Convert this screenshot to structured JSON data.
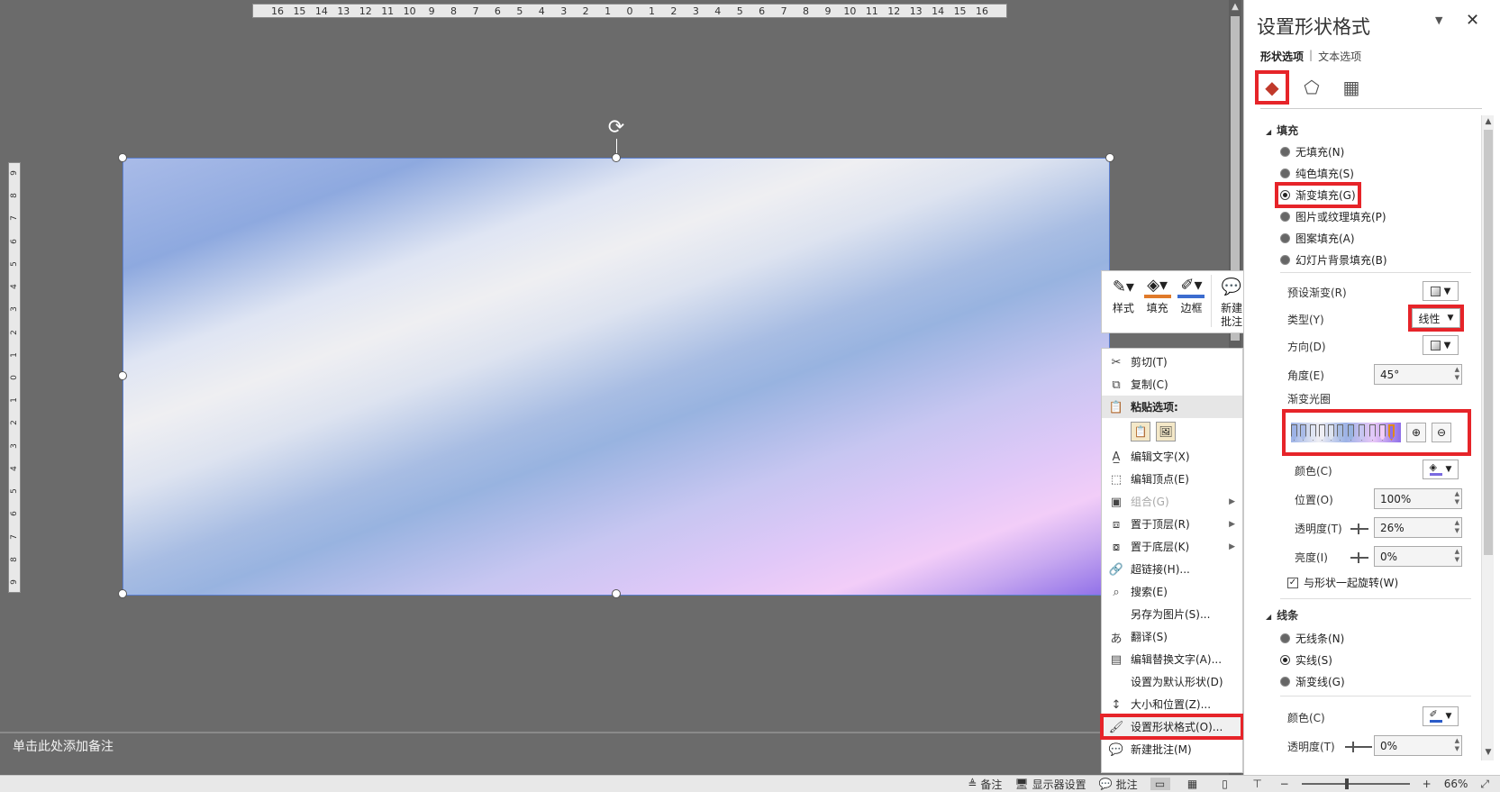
{
  "ruler": {
    "h": [
      "16",
      "15",
      "14",
      "13",
      "12",
      "11",
      "10",
      "9",
      "8",
      "7",
      "6",
      "5",
      "4",
      "3",
      "2",
      "1",
      "0",
      "1",
      "2",
      "3",
      "4",
      "5",
      "6",
      "7",
      "8",
      "9",
      "10",
      "11",
      "12",
      "13",
      "14",
      "15",
      "16"
    ],
    "v": [
      "9",
      "8",
      "7",
      "6",
      "5",
      "4",
      "3",
      "2",
      "1",
      "0",
      "1",
      "2",
      "3",
      "4",
      "5",
      "6",
      "7",
      "8",
      "9"
    ]
  },
  "notes": {
    "placeholder": "单击此处添加备注"
  },
  "minibar": {
    "style": "样式",
    "fill": "填充",
    "border": "边框",
    "comment": "新建\n批注"
  },
  "context_menu": {
    "cut": "剪切(T)",
    "copy": "复制(C)",
    "paste_options": "粘贴选项:",
    "edit_text": "编辑文字(X)",
    "edit_points": "编辑顶点(E)",
    "group": "组合(G)",
    "bring_front": "置于顶层(R)",
    "send_back": "置于底层(K)",
    "hyperlink": "超链接(H)...",
    "search": "搜索(E)",
    "save_as_picture": "另存为图片(S)...",
    "translate": "翻译(S)",
    "edit_alt_text": "编辑替换文字(A)...",
    "set_default": "设置为默认形状(D)",
    "size_position": "大小和位置(Z)...",
    "format_shape": "设置形状格式(O)...",
    "new_comment": "新建批注(M)"
  },
  "panel": {
    "title": "设置形状格式",
    "tab_shape": "形状选项",
    "tab_text": "文本选项",
    "fill": {
      "heading": "填充",
      "options": [
        "无填充(N)",
        "纯色填充(S)",
        "渐变填充(G)",
        "图片或纹理填充(P)",
        "图案填充(A)",
        "幻灯片背景填充(B)"
      ],
      "selected": "渐变填充(G)",
      "preset": "预设渐变(R)",
      "type_label": "类型(Y)",
      "type_value": "线性",
      "direction": "方向(D)",
      "angle_label": "角度(E)",
      "angle_value": "45°",
      "stops_label": "渐变光圈",
      "color_label": "颜色(C)",
      "position_label": "位置(O)",
      "position_value": "100%",
      "transparency_label": "透明度(T)",
      "transparency_value": "26%",
      "brightness_label": "亮度(I)",
      "brightness_value": "0%",
      "rotate_with_shape": "与形状一起旋转(W)"
    },
    "line": {
      "heading": "线条",
      "options": [
        "无线条(N)",
        "实线(S)",
        "渐变线(G)"
      ],
      "selected": "实线(S)",
      "color_label": "颜色(C)",
      "transparency_label": "透明度(T)",
      "transparency_value": "0%"
    }
  },
  "status": {
    "notes": "备注",
    "display_settings": "显示器设置",
    "comments": "批注",
    "zoom": "66%"
  },
  "colors": {
    "highlight": "#e62429",
    "accent": "#7a6ae0"
  }
}
